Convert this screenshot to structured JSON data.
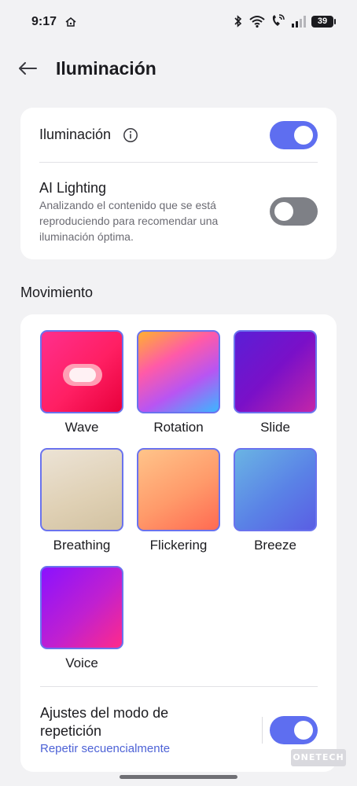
{
  "status_bar": {
    "time": "9:17",
    "battery": "39",
    "icons": [
      "home-icon",
      "bluetooth-icon",
      "wifi-icon",
      "wifi-call-icon",
      "signal-icon",
      "battery-icon"
    ]
  },
  "header": {
    "back_icon": "arrow-left-icon",
    "title": "Iluminación"
  },
  "lighting_card": {
    "illumination": {
      "label": "Iluminación",
      "info_icon": "info-icon",
      "enabled": true
    },
    "ai_lighting": {
      "title": "AI Lighting",
      "description_lines": [
        "Analizando el contenido que se está",
        "reproduciendo para recomendar una",
        "iluminación óptima."
      ],
      "enabled": false
    }
  },
  "movement": {
    "heading": "Movimiento",
    "effects": [
      {
        "label": "Wave",
        "selected": true
      },
      {
        "label": "Rotation"
      },
      {
        "label": "Slide"
      },
      {
        "label": "Breathing"
      },
      {
        "label": "Flickering"
      },
      {
        "label": "Breeze"
      },
      {
        "label": "Voice"
      }
    ],
    "repeat_mode": {
      "title_lines": [
        "Ajustes del modo de",
        "repetición"
      ],
      "value": "Repetir secuencialmente",
      "enabled": true
    }
  },
  "colors": {
    "accent": "#5e6ef0",
    "toggle_off": "#7e8086",
    "link": "#4d62d6",
    "background": "#f2f2f4"
  },
  "watermark": "ONETECH"
}
